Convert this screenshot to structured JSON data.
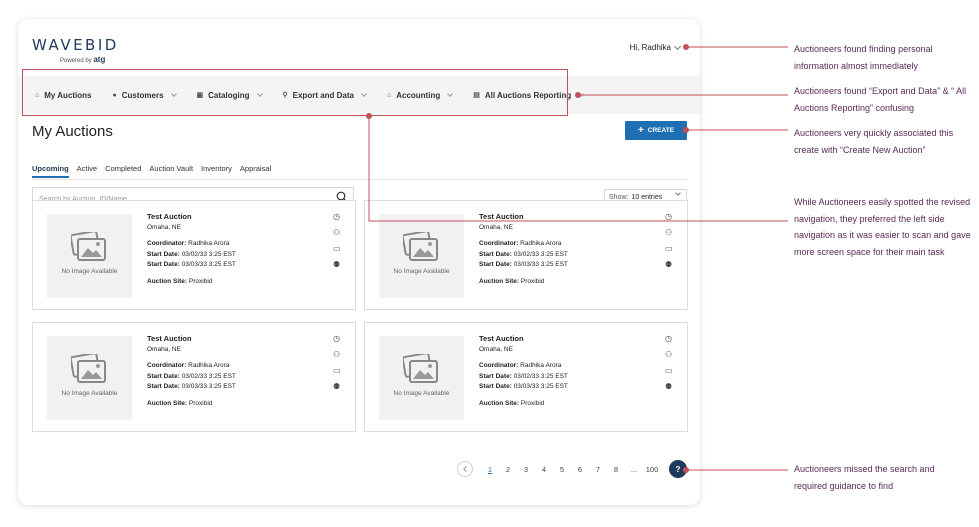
{
  "logo": {
    "word": "WAVEBID",
    "powered": "Powered by",
    "brand": "atg"
  },
  "user": {
    "greeting": "Hi, Radhika"
  },
  "nav": [
    {
      "label": "My Auctions",
      "icon": "home-icon",
      "glyph": "⌂"
    },
    {
      "label": "Customers",
      "icon": "person-icon",
      "glyph": "●"
    },
    {
      "label": "Cataloging",
      "icon": "catalog-icon",
      "glyph": "▣"
    },
    {
      "label": "Export and Data",
      "icon": "link-icon",
      "glyph": "⚲"
    },
    {
      "label": "Accounting",
      "icon": "bank-icon",
      "glyph": "⌂"
    },
    {
      "label": "All Auctions Reporting",
      "icon": "report-icon",
      "glyph": "▤"
    }
  ],
  "page": {
    "title": "My Auctions",
    "create_label": "CREATE"
  },
  "tabs": [
    "Upcoming",
    "Active",
    "Completed",
    "Auction Vault",
    "Inventory",
    "Appraisal"
  ],
  "search": {
    "placeholder": "Search by Auction  ID/Name"
  },
  "show": {
    "label": "Show:",
    "value": "10 entries"
  },
  "cards": [
    {
      "title": "Test Auction",
      "location": "Omaha, NE",
      "coordinator_label": "Coordinator:",
      "coordinator": "Radhika Arora",
      "start_label": "Start Date:",
      "start1": "03/02/33 3:25 EST",
      "start2": "03/03/33 3:25 EST",
      "site_label": "Auction Site:",
      "site": "Proxibid",
      "no_image": "No Image Available"
    },
    {
      "title": "Test Auction",
      "location": "Omaha, NE",
      "coordinator_label": "Coordinator:",
      "coordinator": "Radhika Arora",
      "start_label": "Start Date:",
      "start1": "03/02/33 3:25 EST",
      "start2": "03/03/33 3:25 EST",
      "site_label": "Auction Site:",
      "site": "Proxibid",
      "no_image": "No Image Available"
    },
    {
      "title": "Test Auction",
      "location": "Omaha, NE",
      "coordinator_label": "Coordinator:",
      "coordinator": "Radhika Arora",
      "start_label": "Start Date:",
      "start1": "03/02/33 3:25 EST",
      "start2": "03/03/33 3:25 EST",
      "site_label": "Auction Site:",
      "site": "Proxibid",
      "no_image": "No Image Available"
    },
    {
      "title": "Test Auction",
      "location": "Omaha, NE",
      "coordinator_label": "Coordinator:",
      "coordinator": "Radhika Arora",
      "start_label": "Start Date:",
      "start1": "03/02/33 3:25 EST",
      "start2": "03/03/33 3:25 EST",
      "site_label": "Auction Site:",
      "site": "Proxibid",
      "no_image": "No Image Available"
    }
  ],
  "pagination": {
    "pages": [
      "1",
      "2",
      "3",
      "4",
      "5",
      "6",
      "7",
      "8",
      "...",
      "100"
    ],
    "current": "1",
    "help": "?"
  },
  "annotations": [
    "Auctioneers found finding personal information almost immediately",
    "Auctioneers found “Export and Data” & “ All Auctions Reporting” confusing",
    "Auctioneers very quickly associated this create with “Create New Auction”",
    "While Auctioneers easily spotted the revised navigation, they preferred the left side navigation as it was easier to scan and gave more screen space for their main task",
    "Auctioneers missed the search and required guidance to find"
  ],
  "colors": {
    "accent": "#1f6fb5",
    "navy": "#1f3a5c",
    "annotation_line": "#c0505a",
    "annotation_text": "#5a2a55"
  }
}
